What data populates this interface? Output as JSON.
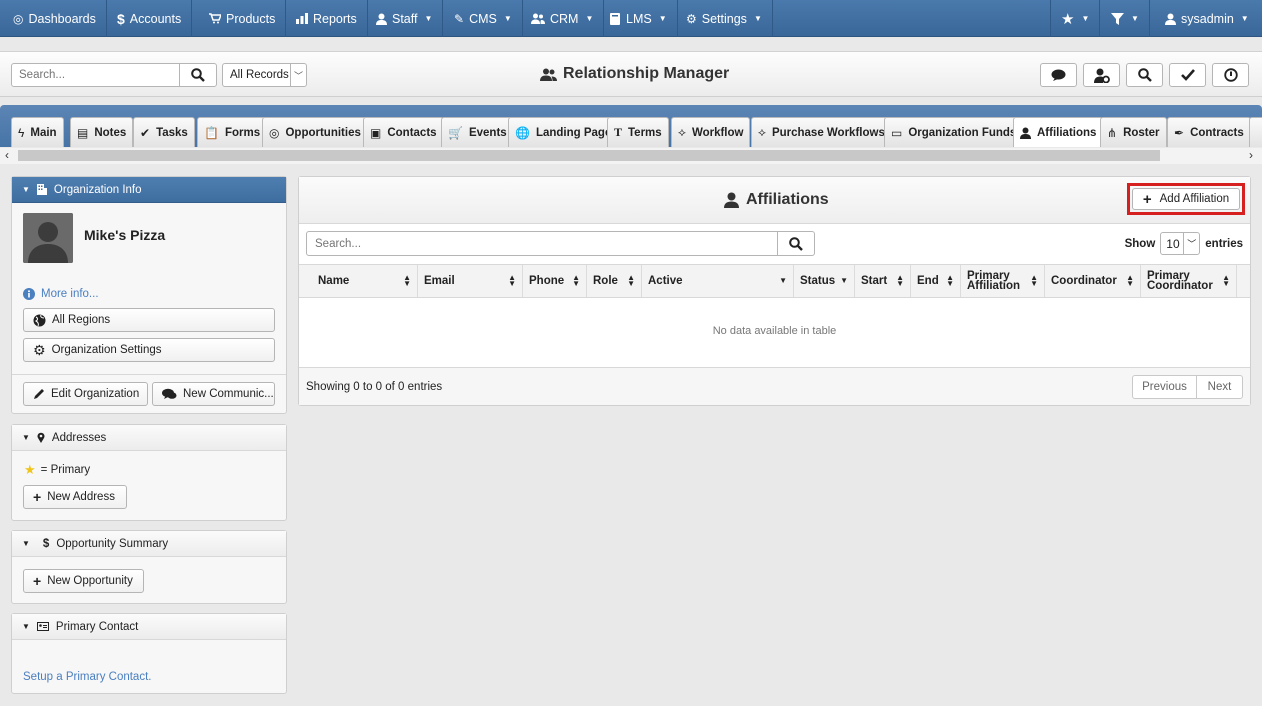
{
  "nav": {
    "items": [
      {
        "label": "Dashboards",
        "icon": "dashboard-icon",
        "glyph": "◎"
      },
      {
        "label": "Accounts",
        "icon": "dollar-icon",
        "glyph": "$"
      },
      {
        "label": "Products",
        "icon": "cart-icon",
        "glyph": "🛒"
      },
      {
        "label": "Reports",
        "icon": "chart-icon",
        "glyph": "📊"
      },
      {
        "label": "Staff",
        "icon": "user-icon",
        "glyph": "👤"
      },
      {
        "label": "CMS",
        "icon": "pencil-icon",
        "glyph": "✎"
      },
      {
        "label": "CRM",
        "icon": "users-icon",
        "glyph": "👥"
      },
      {
        "label": "LMS",
        "icon": "book-icon",
        "glyph": "📖"
      },
      {
        "label": "Settings",
        "icon": "gear-icon",
        "glyph": "⚙"
      }
    ],
    "user": "sysadmin"
  },
  "header": {
    "search_placeholder": "Search...",
    "records_label": "All Records",
    "title": "Relationship Manager"
  },
  "tabs": [
    "Main",
    "Notes",
    "Tasks",
    "Forms",
    "Opportunities",
    "Contacts",
    "Events",
    "Landing Page",
    "Terms",
    "Workflow",
    "Purchase Workflows",
    "Organization Funds",
    "Affiliations",
    "Roster",
    "Contracts"
  ],
  "sidebar": {
    "org_info_title": "Organization Info",
    "org_name": "Mike's Pizza",
    "more_info": "More info...",
    "all_regions": "All Regions",
    "org_settings": "Organization Settings",
    "edit_org": "Edit Organization",
    "new_comm": "New Communic...",
    "addresses_title": "Addresses",
    "primary_legend": "= Primary",
    "new_address": "New Address",
    "opp_summary_title": "Opportunity Summary",
    "new_opportunity": "New Opportunity",
    "primary_contact_title": "Primary Contact",
    "setup_primary": "Setup a Primary Contact."
  },
  "main": {
    "title": "Affiliations",
    "add_button": "Add Affiliation",
    "search_placeholder": "Search...",
    "show_label": "Show",
    "show_value": "10",
    "entries_label": "entries",
    "columns": [
      "Name",
      "Email",
      "Phone",
      "Role",
      "Active",
      "Status",
      "Start",
      "End",
      "Primary Affiliation",
      "Coordinator",
      "Primary Coordinator"
    ],
    "no_data": "No data available in table",
    "info": "Showing 0 to 0 of 0 entries",
    "prev": "Previous",
    "next": "Next"
  }
}
